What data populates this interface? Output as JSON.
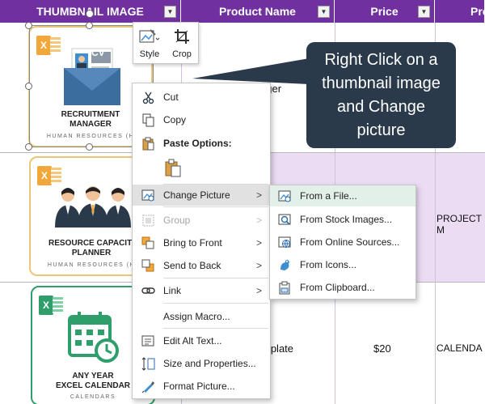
{
  "table": {
    "headers": [
      "THUMBNAIL IMAGE",
      "Product Name",
      "Price",
      "Pro"
    ],
    "rows": [
      {
        "product_fragment": "ager",
        "price": "",
        "extra": ""
      },
      {
        "product_fragment": "",
        "price": "",
        "extra": "PROJECT M"
      },
      {
        "product_fragment": "mplate",
        "price": "$20",
        "extra": "CALENDA"
      }
    ]
  },
  "thumbnails": [
    {
      "line1": "RECRUITMENT",
      "line2": "MANAGER",
      "sub": "HUMAN RESOURCES (H",
      "badge": "CV"
    },
    {
      "line1": "RESOURCE CAPACITI",
      "line2": "PLANNER",
      "sub": "HUMAN RESOURCES (H"
    },
    {
      "line1": "ANY YEAR",
      "line2": "EXCEL CALENDAR",
      "sub": "CALENDARS"
    }
  ],
  "mini_toolbar": {
    "style_label": "Style",
    "crop_label": "Crop"
  },
  "context_menu": {
    "cut": "Cut",
    "copy": "Copy",
    "paste_options": "Paste Options:",
    "change_picture": "Change Picture",
    "group": "Group",
    "bring_to_front": "Bring to Front",
    "send_to_back": "Send to Back",
    "link": "Link",
    "assign_macro": "Assign Macro...",
    "edit_alt_text": "Edit Alt Text...",
    "size_and_properties": "Size and Properties...",
    "format_picture": "Format Picture..."
  },
  "submenu": {
    "from_file": "From a File...",
    "from_stock": "From Stock Images...",
    "from_online": "From Online Sources...",
    "from_icons": "From Icons...",
    "from_clipboard": "From Clipboard..."
  },
  "callout": {
    "text": "Right Click on a thumbnail image and Change picture"
  },
  "colors": {
    "header_bg": "#7030a0",
    "row_highlight": "#ebdcf3",
    "callout_bg": "#2b3a4b",
    "submenu_hover": "#e3f0ea",
    "excel_green": "#2e9e6b",
    "excel_orange": "#f2a73b"
  }
}
